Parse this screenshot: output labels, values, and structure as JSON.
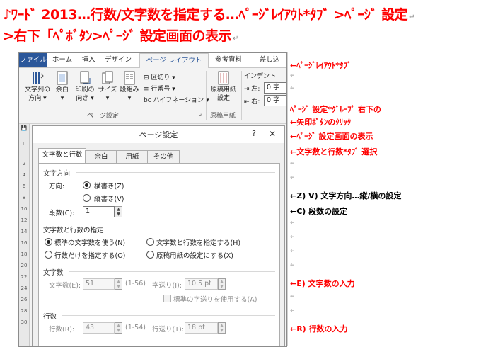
{
  "heading": {
    "line1": "♪ﾜｰﾄﾞ 2013…行数/文字数を指定する…ﾍﾟｰｼﾞﾚｲｱｳﾄ*ﾀﾌﾞ >ﾍﾟｰｼﾞ 設定",
    "line2": ">右下「ﾍﾟﾎﾞﾀﾝ>ﾍﾟｰｼﾞ 設定画面の表示",
    "para_mark": "↵"
  },
  "ribbon": {
    "tabs": [
      "ファイル",
      "ホーム",
      "挿入",
      "デザイン",
      "ページ レイアウト",
      "参考資料",
      "差し込"
    ],
    "buttons": [
      {
        "label1": "文字列の",
        "label2": "方向 ▾"
      },
      {
        "label1": "余白",
        "label2": "▾"
      },
      {
        "label1": "印刷の",
        "label2": "向き ▾"
      },
      {
        "label1": "サイズ",
        "label2": "▾"
      },
      {
        "label1": "段組み",
        "label2": "▾"
      }
    ],
    "small_items": [
      "区切り ▾",
      "行番号 ▾",
      "ハイフネーション ▾"
    ],
    "group1_label": "ページ設定",
    "genko_label1": "原稿用紙",
    "genko_label2": "設定",
    "group2_label": "原稿用紙",
    "indent_label": "インデント",
    "indent_left": "左:",
    "indent_right": "右:",
    "indent_left_val": "0 字",
    "indent_right_val": "0 字"
  },
  "ruler": [
    "2",
    "4",
    "6",
    "8",
    "10",
    "12",
    "14",
    "16",
    "18",
    "20",
    "22",
    "24",
    "26",
    "28",
    "30"
  ],
  "dialog": {
    "title": "ページ設定",
    "help": "?",
    "close": "✕",
    "tabs": [
      "文字数と行数",
      "余白",
      "用紙",
      "その他"
    ],
    "text_direction_section": "文字方向",
    "direction_label": "方向:",
    "horizontal": "横書き(Z)",
    "vertical": "縦書き(V)",
    "columns_label": "段数(C):",
    "columns_value": "1",
    "grid_section": "文字数と行数の指定",
    "opt_standard": "標準の文字数を使う(N)",
    "opt_chars_lines": "文字数と行数を指定する(H)",
    "opt_lines_only": "行数だけを指定する(O)",
    "opt_genko": "原稿用紙の設定にする(X)",
    "chars_section": "文字数",
    "chars_label": "文字数(E):",
    "chars_value": "51",
    "chars_range": "(1-56)",
    "char_pitch_label": "字送り(I):",
    "char_pitch_value": "10.5 pt",
    "use_standard_pitch": "標準の字送りを使用する(A)",
    "lines_section": "行数",
    "lines_label": "行数(R):",
    "lines_value": "43",
    "lines_range": "(1-54)",
    "line_pitch_label": "行送り(T):",
    "line_pitch_value": "18 pt"
  },
  "annotations": [
    "←ﾍﾟｰｼﾞﾚｲｱｳﾄ*ﾀﾌﾞ",
    "ﾍﾟｰｼﾞ 設定*ｸﾞﾙｰﾌﾟ 右下の",
    "←矢印ﾎﾞﾀﾝのｸﾘｯｸ",
    "←ﾍﾟｰｼﾞ 設定画面の表示",
    "←文字数と行数*ﾀﾌﾞ 選択",
    "←Z) V) 文字方向…縦/横の設定",
    "←C) 段数の設定",
    "←E) 文字数の入力",
    "←R) 行数の入力"
  ]
}
